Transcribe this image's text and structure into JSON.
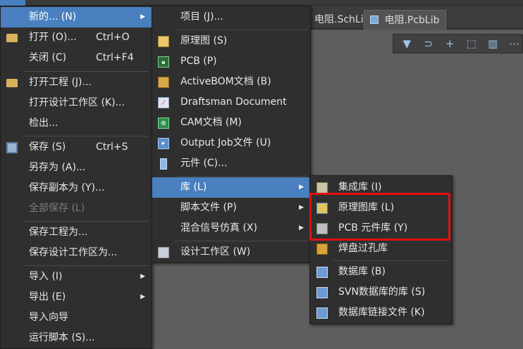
{
  "tabs": [
    {
      "label": "电阻.SchLib"
    },
    {
      "label": "电阻.PcbLib"
    }
  ],
  "toolbar": {
    "buttons": [
      "filter-icon",
      "route-icon",
      "crosshair-icon",
      "select-rect-icon",
      "chart-icon",
      "more-icon"
    ]
  },
  "file_menu": {
    "items": {
      "new": {
        "label": "新的... (N)"
      },
      "open": {
        "label": "打开 (O)...",
        "shortcut": "Ctrl+O"
      },
      "close": {
        "label": "关闭 (C)",
        "shortcut": "Ctrl+F4"
      },
      "open_project": {
        "label": "打开工程 (J)..."
      },
      "open_workspace": {
        "label": "打开设计工作区 (K)..."
      },
      "checkout": {
        "label": "检出..."
      },
      "save": {
        "label": "保存 (S)",
        "shortcut": "Ctrl+S"
      },
      "save_as": {
        "label": "另存为 (A)..."
      },
      "save_copy": {
        "label": "保存副本为 (Y)..."
      },
      "save_all": {
        "label": "全部保存 (L)"
      },
      "save_project_as": {
        "label": "保存工程为..."
      },
      "save_workspace_as": {
        "label": "保存设计工作区为..."
      },
      "import": {
        "label": "导入 (I)"
      },
      "export": {
        "label": "导出 (E)"
      },
      "import_wizard": {
        "label": "导入向导"
      },
      "run_script": {
        "label": "运行脚本 (S)..."
      }
    }
  },
  "new_menu": {
    "items": {
      "project": {
        "label": "项目 (J)..."
      },
      "schematic": {
        "label": "原理图 (S)"
      },
      "pcb": {
        "label": "PCB (P)"
      },
      "activebom": {
        "label": "ActiveBOM文档 (B)"
      },
      "draftsman": {
        "label": "Draftsman Document"
      },
      "cam": {
        "label": "CAM文档 (M)"
      },
      "output_job": {
        "label": "Output Job文件 (U)"
      },
      "component": {
        "label": "元件 (C)..."
      },
      "library": {
        "label": "库 (L)"
      },
      "script": {
        "label": "脚本文件 (P)"
      },
      "mixed_sim": {
        "label": "混合信号仿真 (X)"
      },
      "workspace": {
        "label": "设计工作区 (W)"
      }
    }
  },
  "library_menu": {
    "items": {
      "integrated": {
        "label": "集成库 (I)"
      },
      "schlib": {
        "label": "原理图库 (L)"
      },
      "pcblib": {
        "label": "PCB 元件库 (Y)"
      },
      "padvia": {
        "label": "焊盘过孔库"
      },
      "database": {
        "label": "数据库 (B)"
      },
      "svn_database": {
        "label": "SVN数据库的库 (S)"
      },
      "db_link": {
        "label": "数据库链接文件 (K)"
      }
    }
  },
  "colors": {
    "highlight": "#4a80c0",
    "annotation_box": "#e01010",
    "menu_bg": "#2f2f2f"
  }
}
